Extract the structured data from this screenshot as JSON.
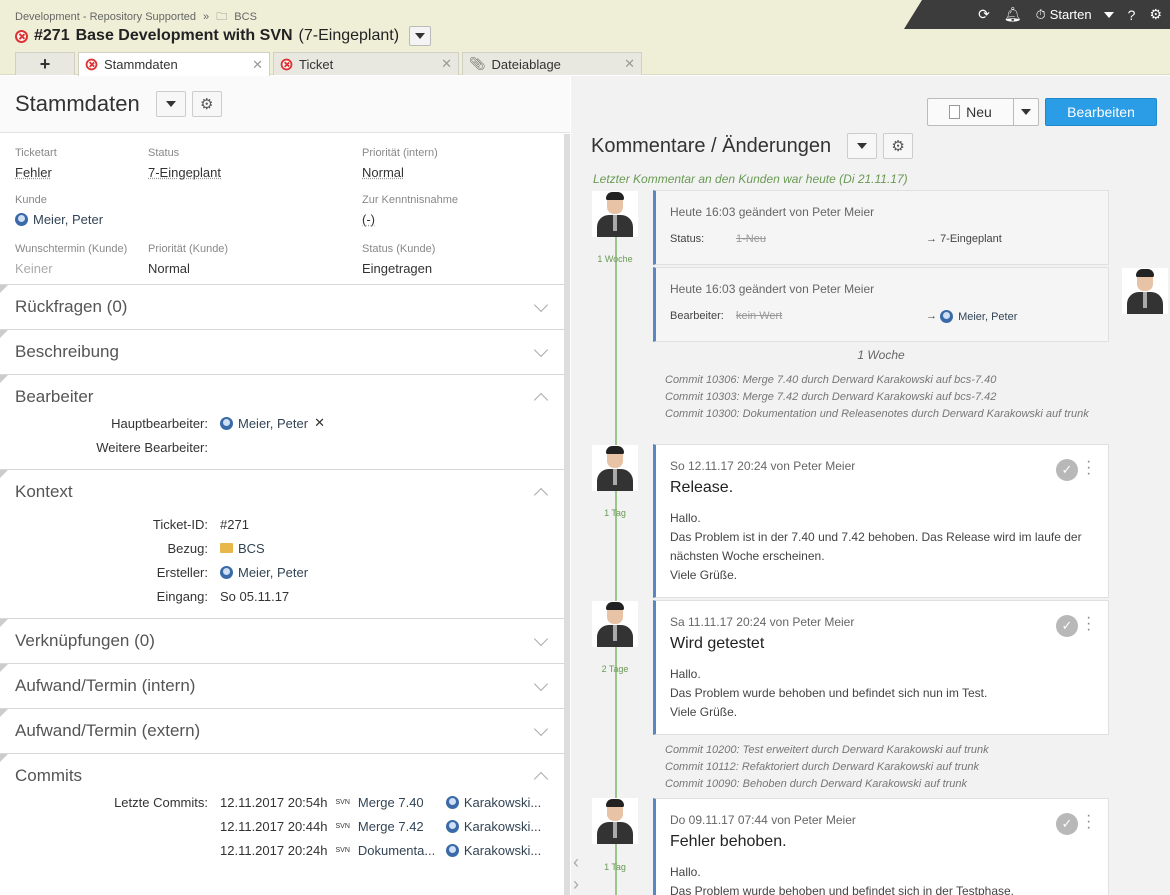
{
  "breadcrumb": {
    "project": "Development - Repository Supported",
    "sep": "»",
    "folder": "BCS"
  },
  "ticket": {
    "number": "#271",
    "title": "Base Development with SVN",
    "status": "(7-Eingeplant)"
  },
  "toolbar": {
    "start_label": "Starten"
  },
  "tabs": [
    {
      "label": "+"
    },
    {
      "label": "Stammdaten"
    },
    {
      "label": "Ticket"
    },
    {
      "label": "Dateiablage"
    }
  ],
  "left": {
    "title": "Stammdaten",
    "fields": [
      {
        "label": "Ticketart",
        "value": "Fehler"
      },
      {
        "label": "Status",
        "value": "7-Eingeplant"
      },
      {
        "label": "Priorität (intern)",
        "value": "Normal"
      },
      {
        "label": "Kunde",
        "value": "Meier, Peter"
      },
      {
        "label": "",
        "value": ""
      },
      {
        "label": "Zur Kenntnisnahme",
        "value": "(-)"
      },
      {
        "label": "Wunschtermin (Kunde)",
        "value": "Keiner"
      },
      {
        "label": "Priorität (Kunde)",
        "value": "Normal"
      },
      {
        "label": "Status (Kunde)",
        "value": "Eingetragen"
      }
    ],
    "sections": {
      "rueckfragen": "Rückfragen (0)",
      "beschreibung": "Beschreibung",
      "bearbeiter": "Bearbeiter",
      "kontext": "Kontext",
      "verknuepfungen": "Verknüpfungen (0)",
      "aufwand_intern": "Aufwand/Termin (intern)",
      "aufwand_extern": "Aufwand/Termin (extern)",
      "commits": "Commits"
    },
    "bearbeiter": {
      "haupt_label": "Hauptbearbeiter:",
      "haupt_value": "Meier, Peter",
      "weitere_label": "Weitere Bearbeiter:"
    },
    "kontext": {
      "ticketid_label": "Ticket-ID:",
      "ticketid_value": "#271",
      "bezug_label": "Bezug:",
      "bezug_value": "BCS",
      "ersteller_label": "Ersteller:",
      "ersteller_value": "Meier, Peter",
      "eingang_label": "Eingang:",
      "eingang_value": "So 05.11.17"
    },
    "commits": {
      "label": "Letzte Commits:",
      "rows": [
        {
          "date": "12.11.2017 20:54h",
          "msg": "Merge 7.40",
          "user": "Karakowski..."
        },
        {
          "date": "12.11.2017 20:44h",
          "msg": "Merge 7.42",
          "user": "Karakowski..."
        },
        {
          "date": "12.11.2017 20:24h",
          "msg": "Dokumenta...",
          "user": "Karakowski..."
        }
      ]
    }
  },
  "right": {
    "title": "Kommentare / Änderungen",
    "neu_label": "Neu",
    "edit_label": "Bearbeiten",
    "info": "Letzter Kommentar an den Kunden war heute (Di 21.11.17)",
    "change1": {
      "meta": "Heute 16:03 geändert von Peter Meier",
      "key": "Status:",
      "old": "1-Neu",
      "new": "7-Eingeplant"
    },
    "change2": {
      "meta": "Heute 16:03 geändert von Peter Meier",
      "key": "Bearbeiter:",
      "old": "kein Wert",
      "new": "Meier, Peter"
    },
    "sep1": "1 Woche",
    "commits1": [
      "Commit 10306: Merge 7.40 durch Derward Karakowski auf bcs-7.40",
      "Commit 10303: Merge 7.42 durch Derward Karakowski auf bcs-7.42",
      "Commit 10300: Dokumentation und Releasenotes durch Derward Karakowski auf trunk"
    ],
    "c1": {
      "meta": "So 12.11.17 20:24 von Peter Meier",
      "title": "Release.",
      "lines": [
        "Hallo.",
        "Das Problem ist in der 7.40 und 7.42 behoben. Das Release wird im laufe der nächsten Woche erscheinen.",
        "Viele Grüße."
      ]
    },
    "c2": {
      "meta": "Sa 11.11.17 20:24 von Peter Meier",
      "title": "Wird getestet",
      "lines": [
        "Hallo.",
        "Das Problem wurde behoben und befindet sich nun im Test.",
        "Viele Grüße."
      ]
    },
    "commits2": [
      "Commit 10200: Test erweitert durch Derward Karakowski auf trunk",
      "Commit 10112: Refaktoriert durch Derward Karakowski auf trunk",
      "Commit 10090: Behoben durch Derward Karakowski auf trunk"
    ],
    "c3": {
      "meta": "Do 09.11.17 07:44 von Peter Meier",
      "title": "Fehler behoben.",
      "lines": [
        "Hallo.",
        "Das Problem wurde behoben und befindet sich in der Testphase."
      ]
    },
    "tl": [
      "1 Woche",
      "1 Tag",
      "2 Tage",
      "1 Tag"
    ]
  }
}
